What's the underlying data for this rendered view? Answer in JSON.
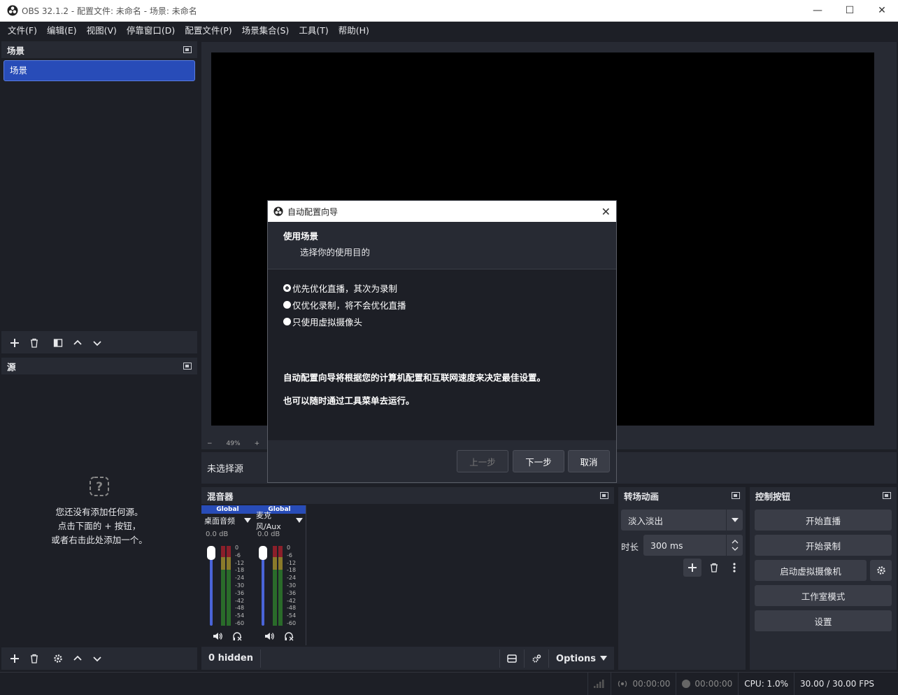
{
  "window": {
    "title": "OBS 32.1.2 - 配置文件: 未命名 - 场景: 未命名",
    "minimize": "—",
    "maximize": "☐",
    "close": "✕"
  },
  "menu": [
    "文件(F)",
    "编辑(E)",
    "视图(V)",
    "停靠窗口(D)",
    "配置文件(P)",
    "场景集合(S)",
    "工具(T)",
    "帮助(H)"
  ],
  "scenes": {
    "title": "场景",
    "items": [
      "场景"
    ]
  },
  "sources": {
    "title": "源",
    "empty_line1": "您还没有添加任何源。",
    "empty_line2": "点击下面的 + 按钮，",
    "empty_line3": "或者右击此处添加一个。"
  },
  "preview": {
    "zoom": "49%",
    "zoom_minus": "−",
    "zoom_plus": "+",
    "no_source": "未选择源"
  },
  "mixer": {
    "title": "混音器",
    "channels": [
      {
        "badge": "Global",
        "name": "桌面音频",
        "db": "0.0 dB"
      },
      {
        "badge": "Global",
        "name": "麦克风/Aux",
        "db": "0.0 dB"
      }
    ],
    "ticks": [
      "0",
      "-6",
      "-12",
      "-18",
      "-24",
      "-30",
      "-36",
      "-42",
      "-48",
      "-54",
      "-60"
    ],
    "hidden": "0 hidden",
    "options": "Options"
  },
  "transitions": {
    "title": "转场动画",
    "selected": "淡入淡出",
    "duration_label": "时长",
    "duration": "300 ms"
  },
  "controls": {
    "title": "控制按钮",
    "stream": "开始直播",
    "record": "开始录制",
    "vcam": "启动虚拟摄像机",
    "studio": "工作室模式",
    "settings": "设置"
  },
  "status": {
    "stream_time": "00:00:00",
    "rec_time": "00:00:00",
    "cpu": "CPU: 1.0%",
    "fps": "30.00 / 30.00 FPS"
  },
  "dialog": {
    "title": "自动配置向导",
    "heading": "使用场景",
    "subheading": "选择你的使用目的",
    "options": [
      "优先优化直播，其次为录制",
      "仅优化录制，将不会优化直播",
      "只使用虚拟摄像头"
    ],
    "info1": "自动配置向导将根据您的计算机配置和互联网速度来决定最佳设置。",
    "info2": "也可以随时通过工具菜单去运行。",
    "back": "上一步",
    "next": "下一步",
    "cancel": "取消"
  }
}
